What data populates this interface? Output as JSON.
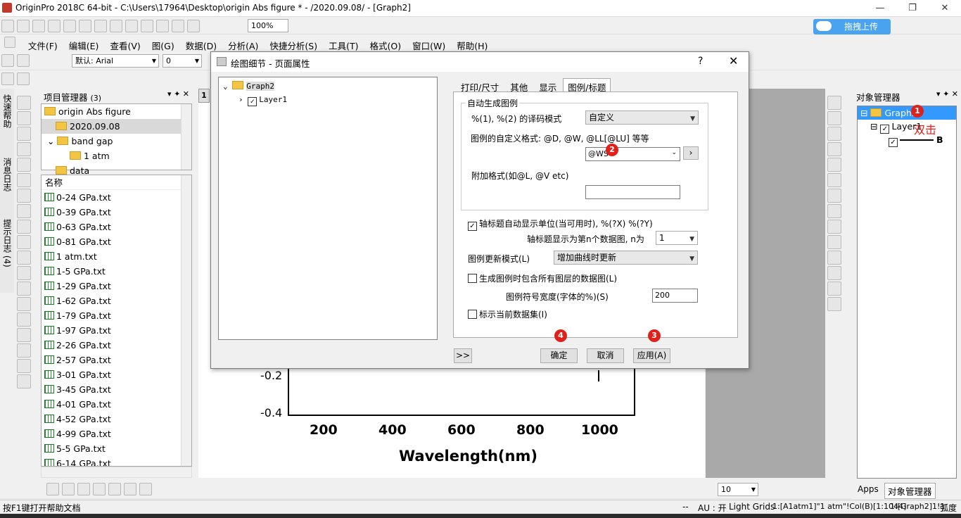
{
  "window": {
    "title": "OriginPro 2018C 64-bit - C:\\Users\\17964\\Desktop\\origin Abs figure * - /2020.09.08/ - [Graph2]"
  },
  "toolbar": {
    "zoom": "100%",
    "font_name": "默认: Arial",
    "font_size": "0",
    "upload_label": "拖拽上传",
    "line_width": "10"
  },
  "menu": [
    "文件(F)",
    "编辑(E)",
    "查看(V)",
    "图(G)",
    "数据(D)",
    "分析(A)",
    "快捷分析(S)",
    "工具(T)",
    "格式(O)",
    "窗口(W)",
    "帮助(H)"
  ],
  "side_tabs": [
    "快速帮助",
    "消息日志",
    "提示日志 (4)"
  ],
  "project_manager": {
    "title": "项目管理器",
    "count": "(3)",
    "tree": [
      "origin Abs figure",
      "2020.09.08",
      "band gap",
      "1 atm",
      "data"
    ],
    "list_header": "名称",
    "files": [
      "0-24 GPa.txt",
      "0-39 GPa.txt",
      "0-63 GPa.txt",
      "0-81 GPa.txt",
      "1 atm.txt",
      "1-5 GPa.txt",
      "1-29 GPa.txt",
      "1-62 GPa.txt",
      "1-79 GPa.txt",
      "1-97 GPa.txt",
      "2-26 GPa.txt",
      "2-57 GPa.txt",
      "3-01 GPa.txt",
      "3-45 GPa.txt",
      "4-01 GPa.txt",
      "4-52 GPa.txt",
      "4-99 GPa.txt",
      "5-5 GPa.txt",
      "6-14 GPa.txt"
    ]
  },
  "graph": {
    "layer_num": "1",
    "y_ticks": [
      "-0.2",
      "-0.4"
    ],
    "x_ticks": [
      "200",
      "400",
      "600",
      "800",
      "1000"
    ],
    "x_label": "Wavelength(nm)"
  },
  "dialog": {
    "title": "绘图细节 - 页面属性",
    "help": "?",
    "tree_root": "Graph2",
    "tree_child": "Layer1",
    "tabs": [
      "打印/尺寸",
      "其他",
      "显示",
      "图例/标题"
    ],
    "group_title": "自动生成图例",
    "decode_label": "%(1), %(2) 的译码模式",
    "decode_value": "自定义",
    "custom_format_label": "图例的自定义格式: @D, @W, @LL[@LU] 等等",
    "custom_format_value": "@WS",
    "extra_format_label": "附加格式(如@L, @V etc)",
    "extra_format_value": "",
    "axis_unit_label": "轴标题自动显示单位(当可用时), %(?X) %(?Y)",
    "axis_nth_label": "轴标题显示为第n个数据图, n为",
    "axis_nth_value": "1",
    "update_mode_label": "图例更新模式(L)",
    "update_mode_value": "增加曲线时更新",
    "include_all_label": "生成图例时包含所有图层的数据图(L)",
    "symbol_width_label": "图例符号宽度(字体的%)(S)",
    "symbol_width_value": "200",
    "mark_current_label": "标示当前数据集(I)",
    "more_button": ">>",
    "ok": "确定",
    "cancel": "取消",
    "apply": "应用(A)"
  },
  "badges": [
    "1",
    "2",
    "3",
    "4"
  ],
  "object_manager": {
    "title": "对象管理器",
    "graph": "Graph2",
    "layer": "Layer1",
    "plot": "B",
    "annotation": "双击",
    "tabs": [
      "Apps",
      "对象管理器"
    ]
  },
  "status": {
    "help": "按F1键打开帮助文档",
    "dashes": "--",
    "au": "AU : 开",
    "grids": "Light Grids",
    "col": "1:[A1atm1]\"1 atm\"!Col(B)[1:1044]",
    "graph": "1:[Graph2]1!1",
    "unit": "弧度"
  },
  "colors": {
    "accent_red": "#e0201b",
    "selected_blue": "#3399ff",
    "upload_blue": "#4aa3f0"
  }
}
